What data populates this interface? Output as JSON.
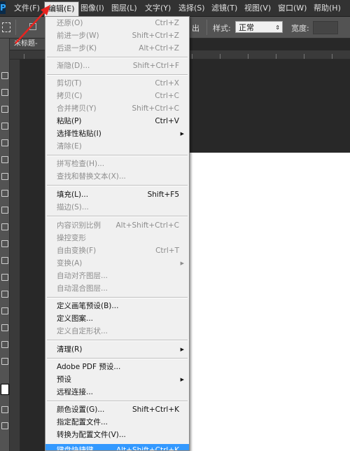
{
  "menubar": {
    "logo": "Ps",
    "items": [
      "文件(F)",
      "编辑(E)",
      "图像(I)",
      "图层(L)",
      "文字(Y)",
      "选择(S)",
      "滤镜(T)",
      "视图(V)",
      "窗口(W)",
      "帮助(H)"
    ],
    "active": "编辑(E)"
  },
  "options_bar": {
    "feather_partial": "出",
    "style_label": "样式:",
    "style_value": "正常",
    "width_label": "宽度:"
  },
  "document": {
    "tab_title": "未标题-"
  },
  "edit_menu": {
    "undo": {
      "label": "还原(O)",
      "shortcut": "Ctrl+Z"
    },
    "step_forward": {
      "label": "前进一步(W)",
      "shortcut": "Shift+Ctrl+Z"
    },
    "step_backward": {
      "label": "后退一步(K)",
      "shortcut": "Alt+Ctrl+Z"
    },
    "fade": {
      "label": "渐隐(D)...",
      "shortcut": "Shift+Ctrl+F"
    },
    "cut": {
      "label": "剪切(T)",
      "shortcut": "Ctrl+X"
    },
    "copy": {
      "label": "拷贝(C)",
      "shortcut": "Ctrl+C"
    },
    "copy_merged": {
      "label": "合并拷贝(Y)",
      "shortcut": "Shift+Ctrl+C"
    },
    "paste": {
      "label": "粘贴(P)",
      "shortcut": "Ctrl+V"
    },
    "paste_special": {
      "label": "选择性粘贴(I)"
    },
    "clear": {
      "label": "清除(E)"
    },
    "check_spelling": {
      "label": "拼写检查(H)..."
    },
    "find_replace": {
      "label": "查找和替换文本(X)..."
    },
    "fill": {
      "label": "填充(L)...",
      "shortcut": "Shift+F5"
    },
    "stroke": {
      "label": "描边(S)..."
    },
    "content_aware_scale": {
      "label": "内容识别比例",
      "shortcut": "Alt+Shift+Ctrl+C"
    },
    "puppet_warp": {
      "label": "操控变形"
    },
    "free_transform": {
      "label": "自由变换(F)",
      "shortcut": "Ctrl+T"
    },
    "transform": {
      "label": "变换(A)"
    },
    "auto_align": {
      "label": "自动对齐图层..."
    },
    "auto_blend": {
      "label": "自动混合图层..."
    },
    "define_brush": {
      "label": "定义画笔预设(B)..."
    },
    "define_pattern": {
      "label": "定义图案..."
    },
    "define_shape": {
      "label": "定义自定形状..."
    },
    "purge": {
      "label": "清理(R)"
    },
    "pdf_presets": {
      "label": "Adobe PDF 预设..."
    },
    "presets": {
      "label": "预设"
    },
    "remote_connections": {
      "label": "远程连接..."
    },
    "color_settings": {
      "label": "颜色设置(G)...",
      "shortcut": "Shift+Ctrl+K"
    },
    "assign_profile": {
      "label": "指定配置文件..."
    },
    "convert_profile": {
      "label": "转换为配置文件(V)..."
    },
    "keyboard_shortcuts": {
      "label": "键盘快捷键...",
      "shortcut": "Alt+Shift+Ctrl+K"
    }
  },
  "colors": {
    "menu_bg": "#f0f0f0",
    "highlight": "#3399ff",
    "annotation_arrow": "#e8231f"
  }
}
